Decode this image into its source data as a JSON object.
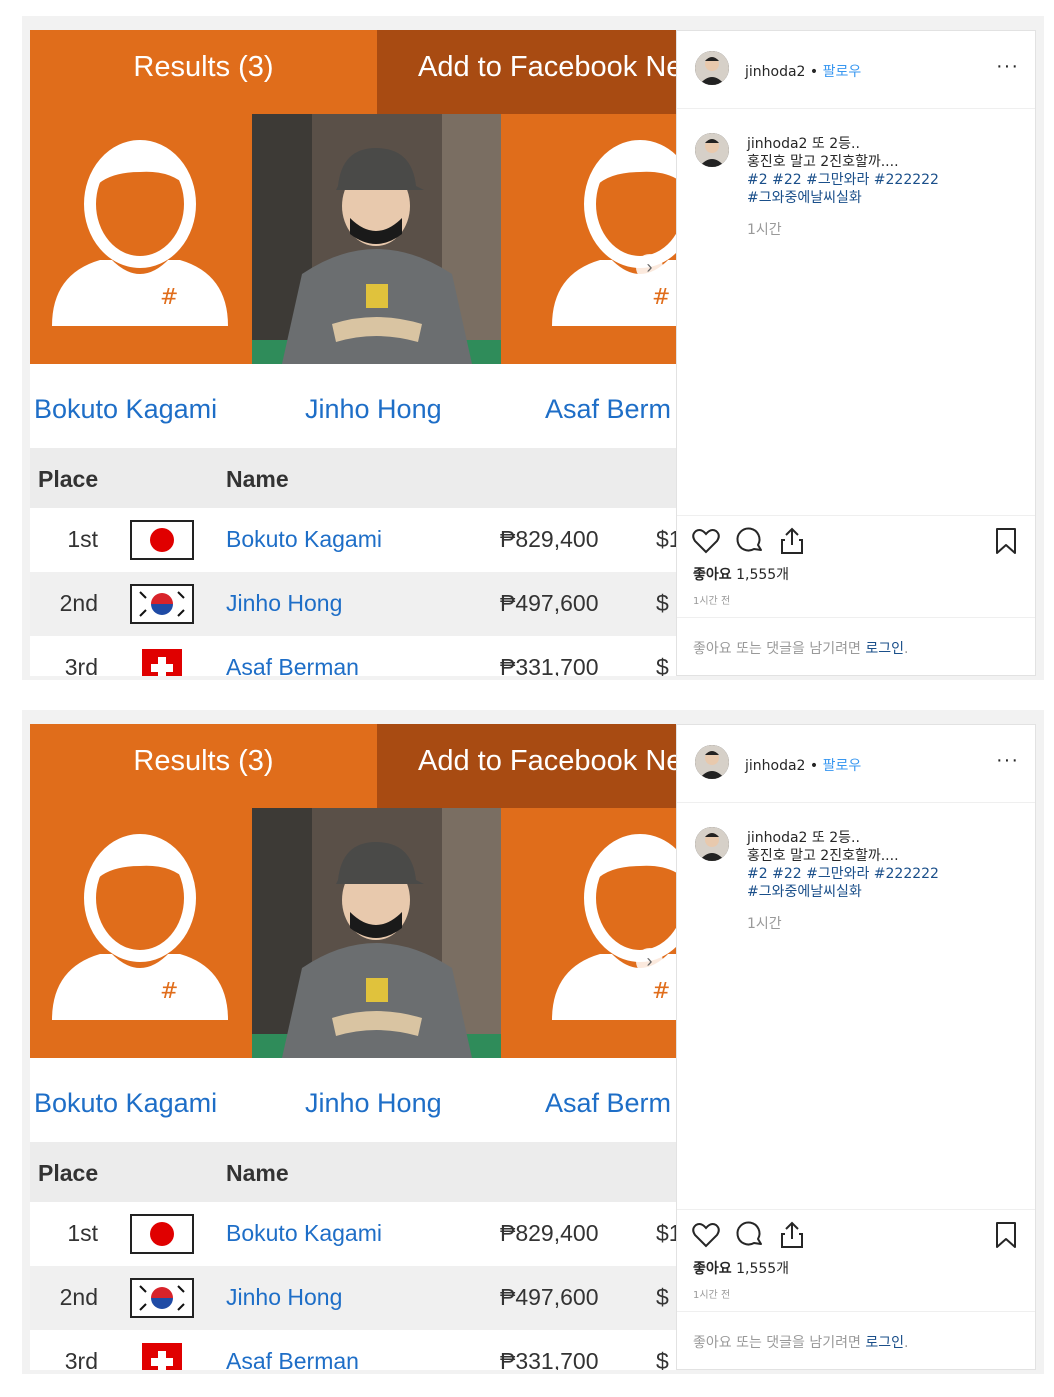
{
  "screens": [
    {
      "tabs": {
        "results": "Results (3)",
        "facebook": "Add to Facebook Ne"
      },
      "players": [
        "Bokuto Kagami",
        "Jinho Hong",
        "Asaf Berm"
      ],
      "table": {
        "headers": {
          "place": "Place",
          "name": "Name"
        },
        "rows": [
          {
            "place": "1st",
            "flag": "japan-flag-icon",
            "name": "Bokuto Kagami",
            "prize": "₱829,400",
            "usd": "$1"
          },
          {
            "place": "2nd",
            "flag": "korea-flag-icon",
            "name": "Jinho Hong",
            "prize": "₱497,600",
            "usd": "$"
          },
          {
            "place": "3rd",
            "flag": "switzerland-flag-icon",
            "name": "Asaf Berman",
            "prize": "₱331,700",
            "usd": "$"
          }
        ]
      },
      "instagram": {
        "username": "jinhoda2",
        "separator": "•",
        "follow": "팔로우",
        "more": "···",
        "caption": {
          "user": "jinhoda2",
          "line1": "또 2등..",
          "line2": "홍진호 말고 2진호할까....",
          "tags1": "#2 #22 #그만와라 #222222",
          "tags2": "#그와중에날씨실화",
          "time": "1시간"
        },
        "likes_label": "좋아요",
        "likes_count": "1,555개",
        "post_time": "1시간 전",
        "login_prompt": "좋아요 또는 댓글을 남기려면",
        "login_link": "로그인",
        "login_period": "."
      }
    },
    {
      "tabs": {
        "results": "Results (3)",
        "facebook": "Add to Facebook Ne"
      },
      "players": [
        "Bokuto Kagami",
        "Jinho Hong",
        "Asaf Berm"
      ],
      "table": {
        "headers": {
          "place": "Place",
          "name": "Name"
        },
        "rows": [
          {
            "place": "1st",
            "flag": "japan-flag-icon",
            "name": "Bokuto Kagami",
            "prize": "₱829,400",
            "usd": "$1"
          },
          {
            "place": "2nd",
            "flag": "korea-flag-icon",
            "name": "Jinho Hong",
            "prize": "₱497,600",
            "usd": "$"
          },
          {
            "place": "3rd",
            "flag": "switzerland-flag-icon",
            "name": "Asaf Berman",
            "prize": "₱331,700",
            "usd": "$"
          }
        ]
      },
      "instagram": {
        "username": "jinhoda2",
        "separator": "•",
        "follow": "팔로우",
        "more": "···",
        "caption": {
          "user": "jinhoda2",
          "line1": "또 2등..",
          "line2": "홍진호 말고 2진호할까....",
          "tags1": "#2 #22 #그만와라 #222222",
          "tags2": "#그와중에날씨실화",
          "time": "1시간"
        },
        "likes_label": "좋아요",
        "likes_count": "1,555개",
        "post_time": "1시간 전",
        "login_prompt": "좋아요 또는 댓글을 남기려면",
        "login_link": "로그인",
        "login_period": "."
      }
    }
  ],
  "colors": {
    "accent_orange": "#e06d1b",
    "tab_dark": "#a84b12",
    "link_blue": "#1e6ec7",
    "ig_follow_blue": "#3897f0",
    "ig_tag_blue": "#1a4f8a"
  }
}
